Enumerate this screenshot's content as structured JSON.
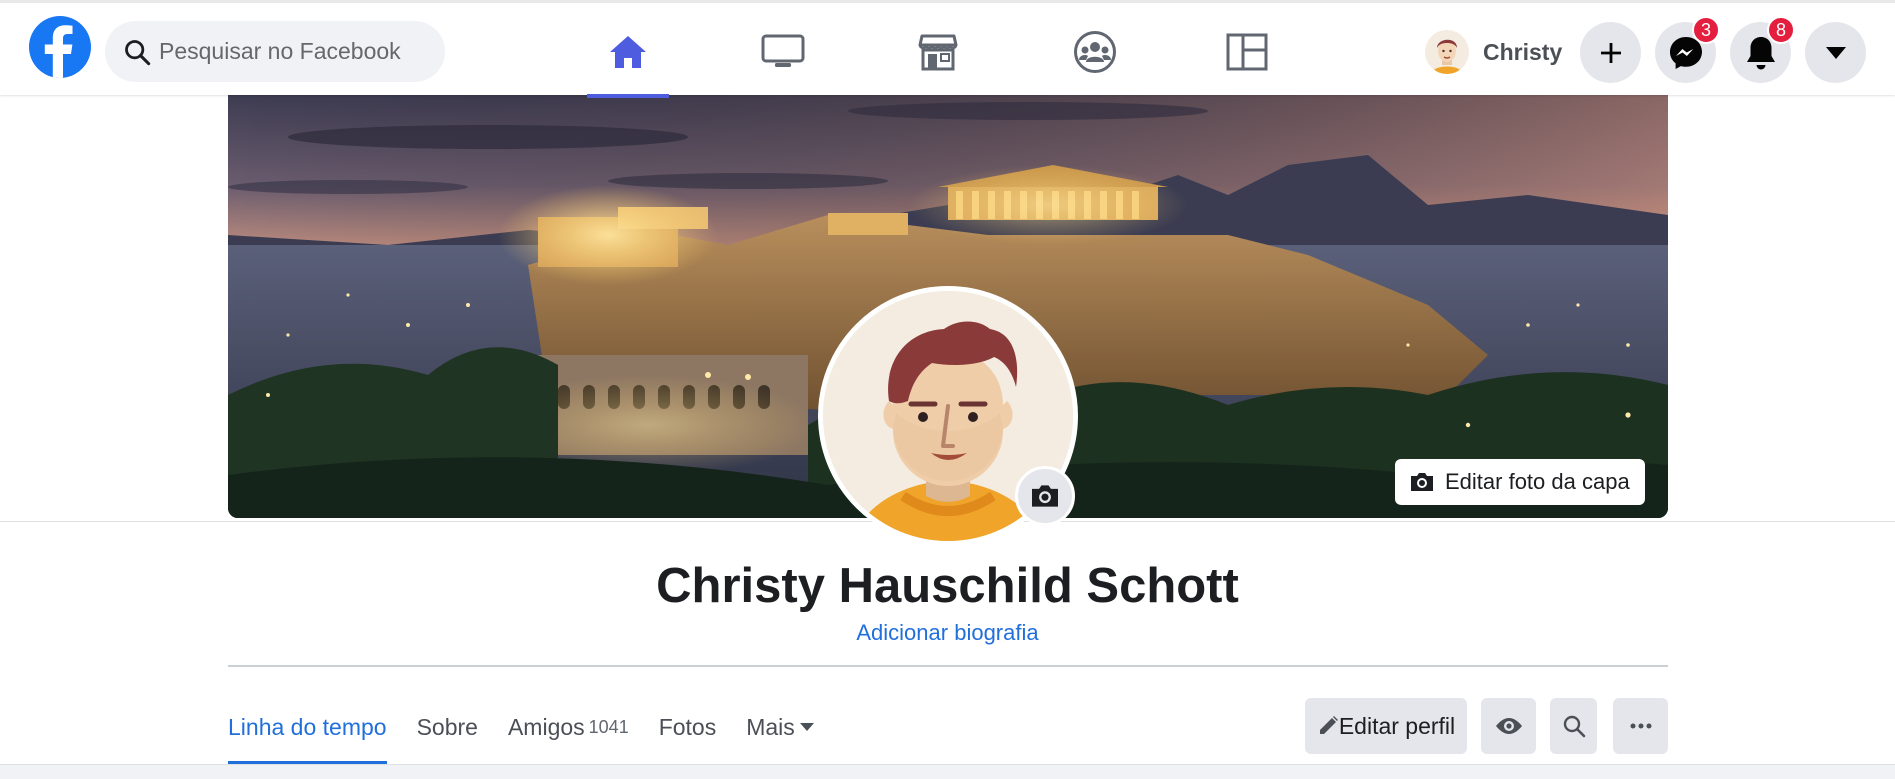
{
  "topbar": {
    "logo_icon": "facebook-logo-icon",
    "search_placeholder": "Pesquisar no Facebook",
    "nav_tabs": [
      {
        "id": "home",
        "icon": "home-icon",
        "active": true
      },
      {
        "id": "watch",
        "icon": "monitor-icon",
        "active": false
      },
      {
        "id": "marketplace",
        "icon": "store-icon",
        "active": false
      },
      {
        "id": "groups",
        "icon": "groups-icon",
        "active": false
      },
      {
        "id": "gaming",
        "icon": "layout-icon",
        "active": false
      }
    ],
    "user_name": "Christy",
    "messenger_badge": "3",
    "notifications_badge": "8"
  },
  "cover": {
    "edit_cover_label": "Editar foto da capa"
  },
  "profile": {
    "name": "Christy Hauschild Schott",
    "bio_link": "Adicionar biografia"
  },
  "tabs": {
    "timeline": "Linha do tempo",
    "about": "Sobre",
    "friends": "Amigos",
    "friends_count": "1041",
    "photos": "Fotos",
    "more": "Mais"
  },
  "actions": {
    "edit_profile": "Editar perfil"
  },
  "colors": {
    "accent": "#216fdb",
    "nav_active": "#4e5ce0",
    "badge": "#e41e3f"
  }
}
